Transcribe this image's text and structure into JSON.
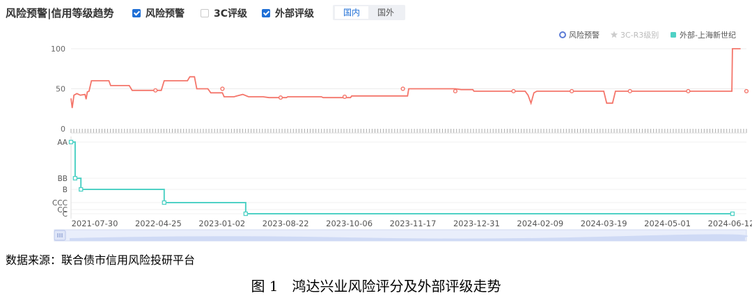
{
  "toolbar": {
    "title": "风险预警|信用等级趋势",
    "toggles": [
      {
        "label": "风险预警",
        "checked": true
      },
      {
        "label": "3C评级",
        "checked": false
      },
      {
        "label": "外部评级",
        "checked": true
      }
    ],
    "region_tabs": [
      {
        "label": "国内",
        "active": true
      },
      {
        "label": "国外",
        "active": false
      }
    ]
  },
  "legend": [
    {
      "label": "风险预警",
      "marker": "circle",
      "color": "#5b7bd5",
      "active": true
    },
    {
      "label": "3C-R3级别",
      "marker": "star",
      "color": "#cccccc",
      "active": false
    },
    {
      "label": "外部-上海新世纪",
      "marker": "square",
      "color": "#4fd1c5",
      "active": true
    }
  ],
  "chart_data": {
    "type": "line",
    "x_tick_labels": [
      "2021-07-30",
      "2022-04-25",
      "2023-01-02",
      "2023-08-22",
      "2023-10-06",
      "2023-11-17",
      "2023-12-31",
      "2024-02-09",
      "2024-03-19",
      "2024-05-01",
      "2024-06-12"
    ],
    "top_panel": {
      "y_ticks": [
        0,
        50,
        100
      ],
      "ylim": [
        0,
        100
      ],
      "series": [
        {
          "color": "#f4756a",
          "points": [
            [
              0.0,
              38
            ],
            [
              0.2,
              26
            ],
            [
              0.5,
              42
            ],
            [
              1.0,
              44
            ],
            [
              1.6,
              42
            ],
            [
              2.4,
              43
            ],
            [
              2.6,
              37
            ],
            [
              2.8,
              46
            ],
            [
              3.1,
              47
            ],
            [
              3.5,
              60
            ],
            [
              6.5,
              60
            ],
            [
              6.8,
              54
            ],
            [
              10.0,
              54
            ],
            [
              10.5,
              48
            ],
            [
              15.5,
              48
            ],
            [
              16.0,
              60
            ],
            [
              20.0,
              60
            ],
            [
              20.4,
              65
            ],
            [
              21.2,
              65
            ],
            [
              21.6,
              50
            ],
            [
              23.5,
              50
            ],
            [
              24.0,
              45
            ],
            [
              26.0,
              45
            ],
            [
              26.3,
              40
            ],
            [
              28.0,
              40
            ],
            [
              28.5,
              41
            ],
            [
              29.5,
              43
            ],
            [
              30.5,
              40
            ],
            [
              33.0,
              40
            ],
            [
              34.0,
              39
            ],
            [
              37.0,
              39
            ],
            [
              37.2,
              40
            ],
            [
              43.0,
              40
            ],
            [
              43.3,
              39
            ],
            [
              48.0,
              39
            ],
            [
              48.2,
              41
            ],
            [
              57.8,
              41
            ],
            [
              58.0,
              50
            ],
            [
              66.0,
              50
            ],
            [
              67.0,
              49
            ],
            [
              69.0,
              49
            ],
            [
              69.2,
              47
            ],
            [
              78.0,
              47
            ],
            [
              78.5,
              42
            ],
            [
              79.0,
              32
            ],
            [
              79.5,
              45
            ],
            [
              80.0,
              47
            ],
            [
              91.5,
              47
            ],
            [
              92.0,
              32
            ],
            [
              93.0,
              32
            ],
            [
              93.5,
              47
            ],
            [
              113.5,
              47
            ],
            [
              113.6,
              100
            ],
            [
              115.0,
              100
            ]
          ],
          "markers": [
            [
              14.5,
              48
            ],
            [
              26.0,
              50
            ],
            [
              36.0,
              39
            ],
            [
              47.0,
              40
            ],
            [
              57.0,
              50
            ],
            [
              66.0,
              47
            ],
            [
              76.0,
              47
            ],
            [
              86.0,
              47
            ],
            [
              96.0,
              47
            ],
            [
              106.0,
              47
            ],
            [
              116.0,
              47
            ]
          ]
        }
      ]
    },
    "bottom_panel": {
      "rating_scale": [
        "AA",
        "BB",
        "B",
        "CCC",
        "CC",
        "C"
      ],
      "series": [
        {
          "color": "#4fd1c5",
          "steps": [
            [
              "AA",
              0.0
            ],
            [
              "BB",
              0.7
            ],
            [
              "B",
              1.7
            ],
            [
              "CCC",
              16.0
            ],
            [
              "C",
              30.0
            ],
            [
              "C",
              113.6
            ]
          ],
          "markers": [
            [
              "AA",
              0.0
            ],
            [
              "BB",
              0.7
            ],
            [
              "B",
              1.7
            ],
            [
              "CCC",
              16.0
            ],
            [
              "C",
              30.0
            ],
            [
              "C",
              113.6
            ]
          ]
        }
      ]
    }
  },
  "caption": {
    "source": "数据来源：联合债市信用风险投研平台",
    "figure": "图 1　鸿达兴业风险评分及外部评级走势"
  }
}
